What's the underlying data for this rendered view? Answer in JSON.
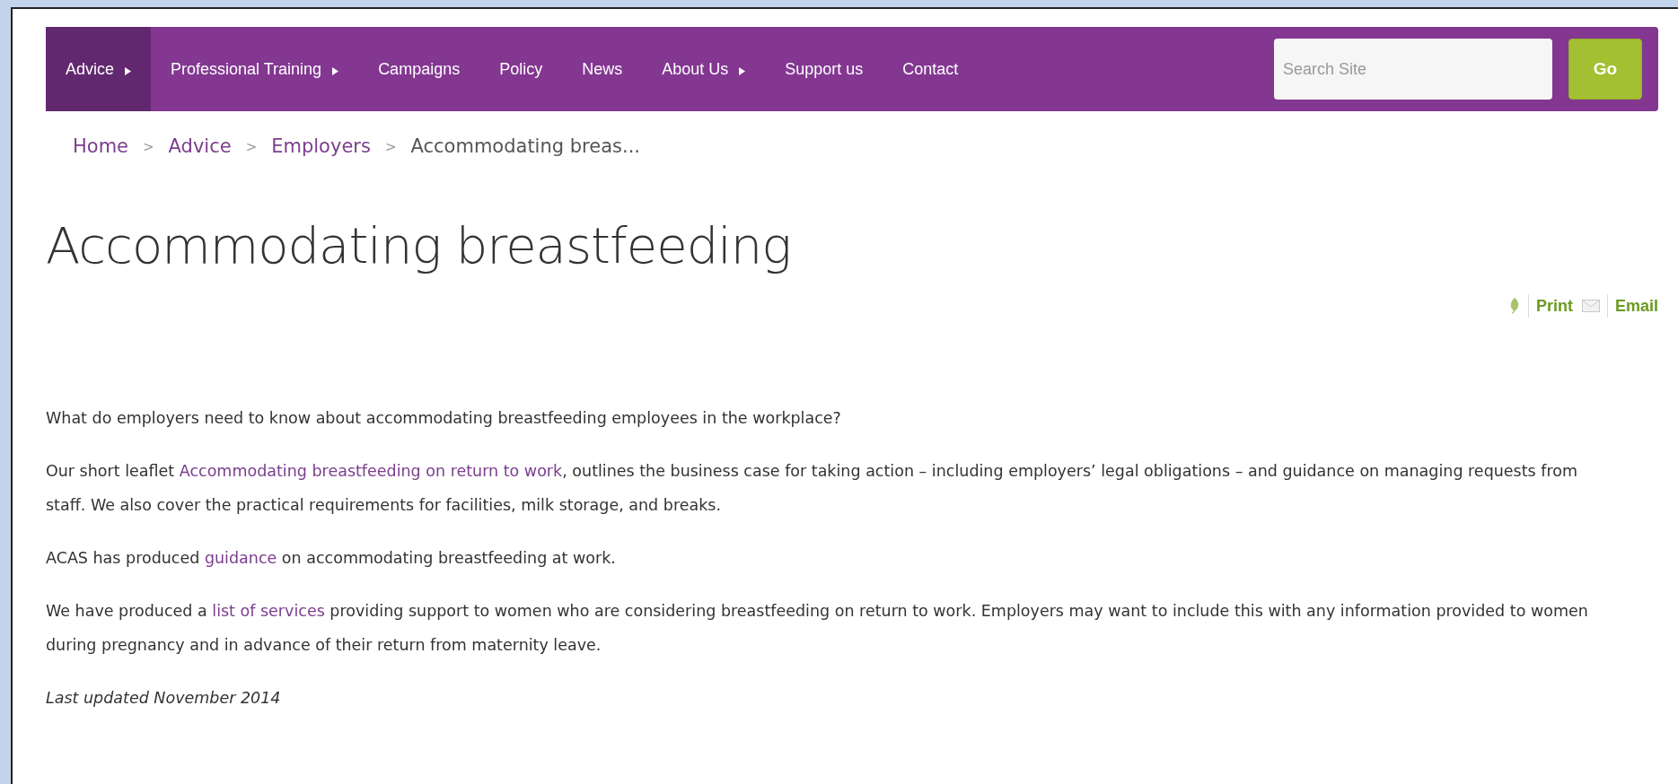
{
  "nav": {
    "items": [
      {
        "label": "Advice",
        "selected": true,
        "submenu": true
      },
      {
        "label": "Professional Training",
        "selected": false,
        "submenu": true
      },
      {
        "label": "Campaigns",
        "selected": false,
        "submenu": false
      },
      {
        "label": "Policy",
        "selected": false,
        "submenu": false
      },
      {
        "label": "News",
        "selected": false,
        "submenu": false
      },
      {
        "label": "About Us",
        "selected": false,
        "submenu": true
      },
      {
        "label": "Support us",
        "selected": false,
        "submenu": false
      },
      {
        "label": "Contact",
        "selected": false,
        "submenu": false
      }
    ],
    "search": {
      "placeholder": "Search Site"
    },
    "go_button": "Go"
  },
  "breadcrumb": {
    "separator": ">",
    "items": [
      {
        "label": "Home",
        "link": true
      },
      {
        "label": "Advice",
        "link": true
      },
      {
        "label": "Employers",
        "link": true
      },
      {
        "label": "Accommodating breas...",
        "link": false
      }
    ]
  },
  "title": "Accommodating breastfeeding",
  "tools": [
    {
      "kind": "print",
      "label": "Print"
    },
    {
      "kind": "email",
      "label": "Email"
    }
  ],
  "paragraphs": [
    {
      "kind": "text",
      "segments": [
        {
          "text": "What do employers need to know about accommodating breastfeeding employees in the workplace?",
          "link": false
        }
      ]
    },
    {
      "kind": "text",
      "segments": [
        {
          "text": "Our short leaflet ",
          "link": false
        },
        {
          "text": "Accommodating breastfeeding on return to work",
          "link": true
        },
        {
          "text": ", outlines the business case for taking action – including employers’ legal obligations – and guidance on managing requests from staff. We also cover the practical requirements for facilities, milk storage, and breaks.",
          "link": false
        }
      ]
    },
    {
      "kind": "text",
      "segments": [
        {
          "text": "ACAS has produced ",
          "link": false
        },
        {
          "text": "guidance",
          "link": true
        },
        {
          "text": " on accommodating breastfeeding at work.",
          "link": false
        }
      ]
    },
    {
      "kind": "text",
      "segments": [
        {
          "text": "We have produced a ",
          "link": false
        },
        {
          "text": "list of services",
          "link": true
        },
        {
          "text": " providing support to women who are considering breastfeeding on return to work.  Employers may want to include this with any information provided to women during pregnancy and in advance of their return from maternity leave.",
          "link": false
        }
      ]
    },
    {
      "kind": "note",
      "segments": [
        {
          "text": "Last updated November 2014",
          "link": false
        }
      ]
    }
  ]
}
